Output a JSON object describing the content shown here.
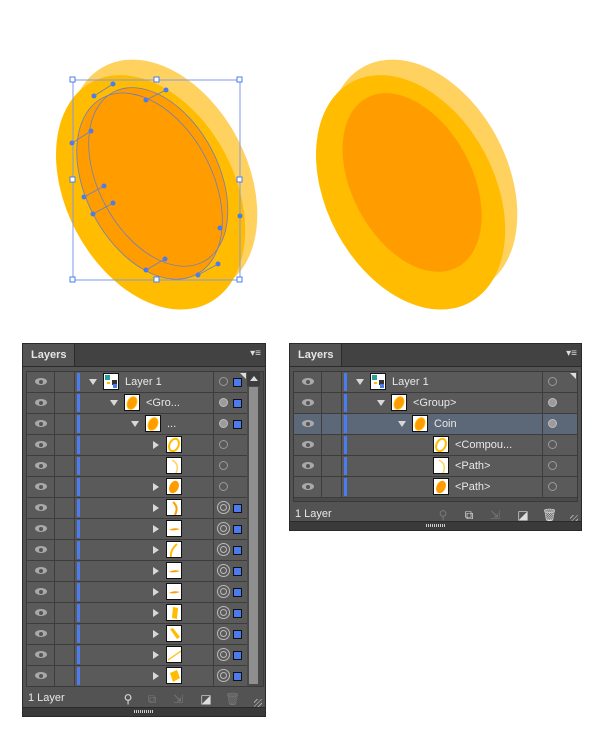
{
  "colors": {
    "coin_face": "#FF9C00",
    "coin_rim": "#FFBC00",
    "coin_edge": "#FFD15F",
    "selection": "#4A7CF0",
    "panel_bg": "#535353"
  },
  "left_panel": {
    "tab_label": "Layers",
    "menu_icon": "panel-menu-icon",
    "footer_count": "1 Layer",
    "footer_icons": [
      "locate-object-icon",
      "make-clipping-mask-icon",
      "create-sublayer-icon",
      "create-new-layer-icon",
      "delete-icon"
    ],
    "rows": [
      {
        "name": "Layer 1",
        "indent": 0,
        "twisty": "down",
        "thumb": "layer",
        "target": "empty",
        "selected_square": true
      },
      {
        "name": "<Gro...",
        "indent": 1,
        "twisty": "down",
        "thumb": "coin",
        "target": "filled",
        "selected_square": true
      },
      {
        "name": "...",
        "indent": 2,
        "twisty": "down",
        "thumb": "coin",
        "target": "filled",
        "selected_square": true
      },
      {
        "name": "",
        "indent": 3,
        "twisty": "right",
        "thumb": "ring",
        "target": "empty",
        "selected_square": false
      },
      {
        "name": "",
        "indent": 3,
        "twisty": "none",
        "thumb": "arc",
        "target": "empty",
        "selected_square": false
      },
      {
        "name": "",
        "indent": 3,
        "twisty": "right",
        "thumb": "oval",
        "target": "empty",
        "selected_square": false
      },
      {
        "name": "",
        "indent": 3,
        "twisty": "right",
        "thumb": "arc-right",
        "target": "double",
        "selected_square": true
      },
      {
        "name": "",
        "indent": 3,
        "twisty": "right",
        "thumb": "sliver",
        "target": "double",
        "selected_square": true
      },
      {
        "name": "",
        "indent": 3,
        "twisty": "right",
        "thumb": "arc-left",
        "target": "double",
        "selected_square": true
      },
      {
        "name": "",
        "indent": 3,
        "twisty": "right",
        "thumb": "sliver",
        "target": "double",
        "selected_square": true
      },
      {
        "name": "",
        "indent": 3,
        "twisty": "right",
        "thumb": "sliver",
        "target": "double",
        "selected_square": true
      },
      {
        "name": "",
        "indent": 3,
        "twisty": "right",
        "thumb": "block",
        "target": "double",
        "selected_square": true
      },
      {
        "name": "",
        "indent": 3,
        "twisty": "right",
        "thumb": "diag-block",
        "target": "double",
        "selected_square": true
      },
      {
        "name": "",
        "indent": 3,
        "twisty": "right",
        "thumb": "line",
        "target": "double",
        "selected_square": true
      },
      {
        "name": "",
        "indent": 3,
        "twisty": "right",
        "thumb": "square",
        "target": "double",
        "selected_square": true
      },
      {
        "name": "",
        "indent": 3,
        "twisty": "right",
        "thumb": "line",
        "target": "double",
        "selected_square": true
      }
    ]
  },
  "right_panel": {
    "tab_label": "Layers",
    "menu_icon": "panel-menu-icon",
    "footer_count": "1 Layer",
    "footer_icons": [
      "locate-object-icon",
      "make-clipping-mask-icon",
      "create-sublayer-icon",
      "create-new-layer-icon",
      "delete-icon"
    ],
    "rows": [
      {
        "name": "Layer 1",
        "indent": 0,
        "twisty": "down",
        "thumb": "layer",
        "target": "empty",
        "selected": false
      },
      {
        "name": "<Group>",
        "indent": 1,
        "twisty": "down",
        "thumb": "coin",
        "target": "filled",
        "selected": false
      },
      {
        "name": "Coin",
        "indent": 2,
        "twisty": "down",
        "thumb": "coin",
        "target": "filled",
        "selected": true
      },
      {
        "name": "<Compou...",
        "indent": 3,
        "twisty": "none",
        "thumb": "ring",
        "target": "empty",
        "selected": false
      },
      {
        "name": "<Path>",
        "indent": 3,
        "twisty": "none",
        "thumb": "arc",
        "target": "empty",
        "selected": false
      },
      {
        "name": "<Path>",
        "indent": 3,
        "twisty": "none",
        "thumb": "oval",
        "target": "empty",
        "selected": false
      }
    ]
  }
}
